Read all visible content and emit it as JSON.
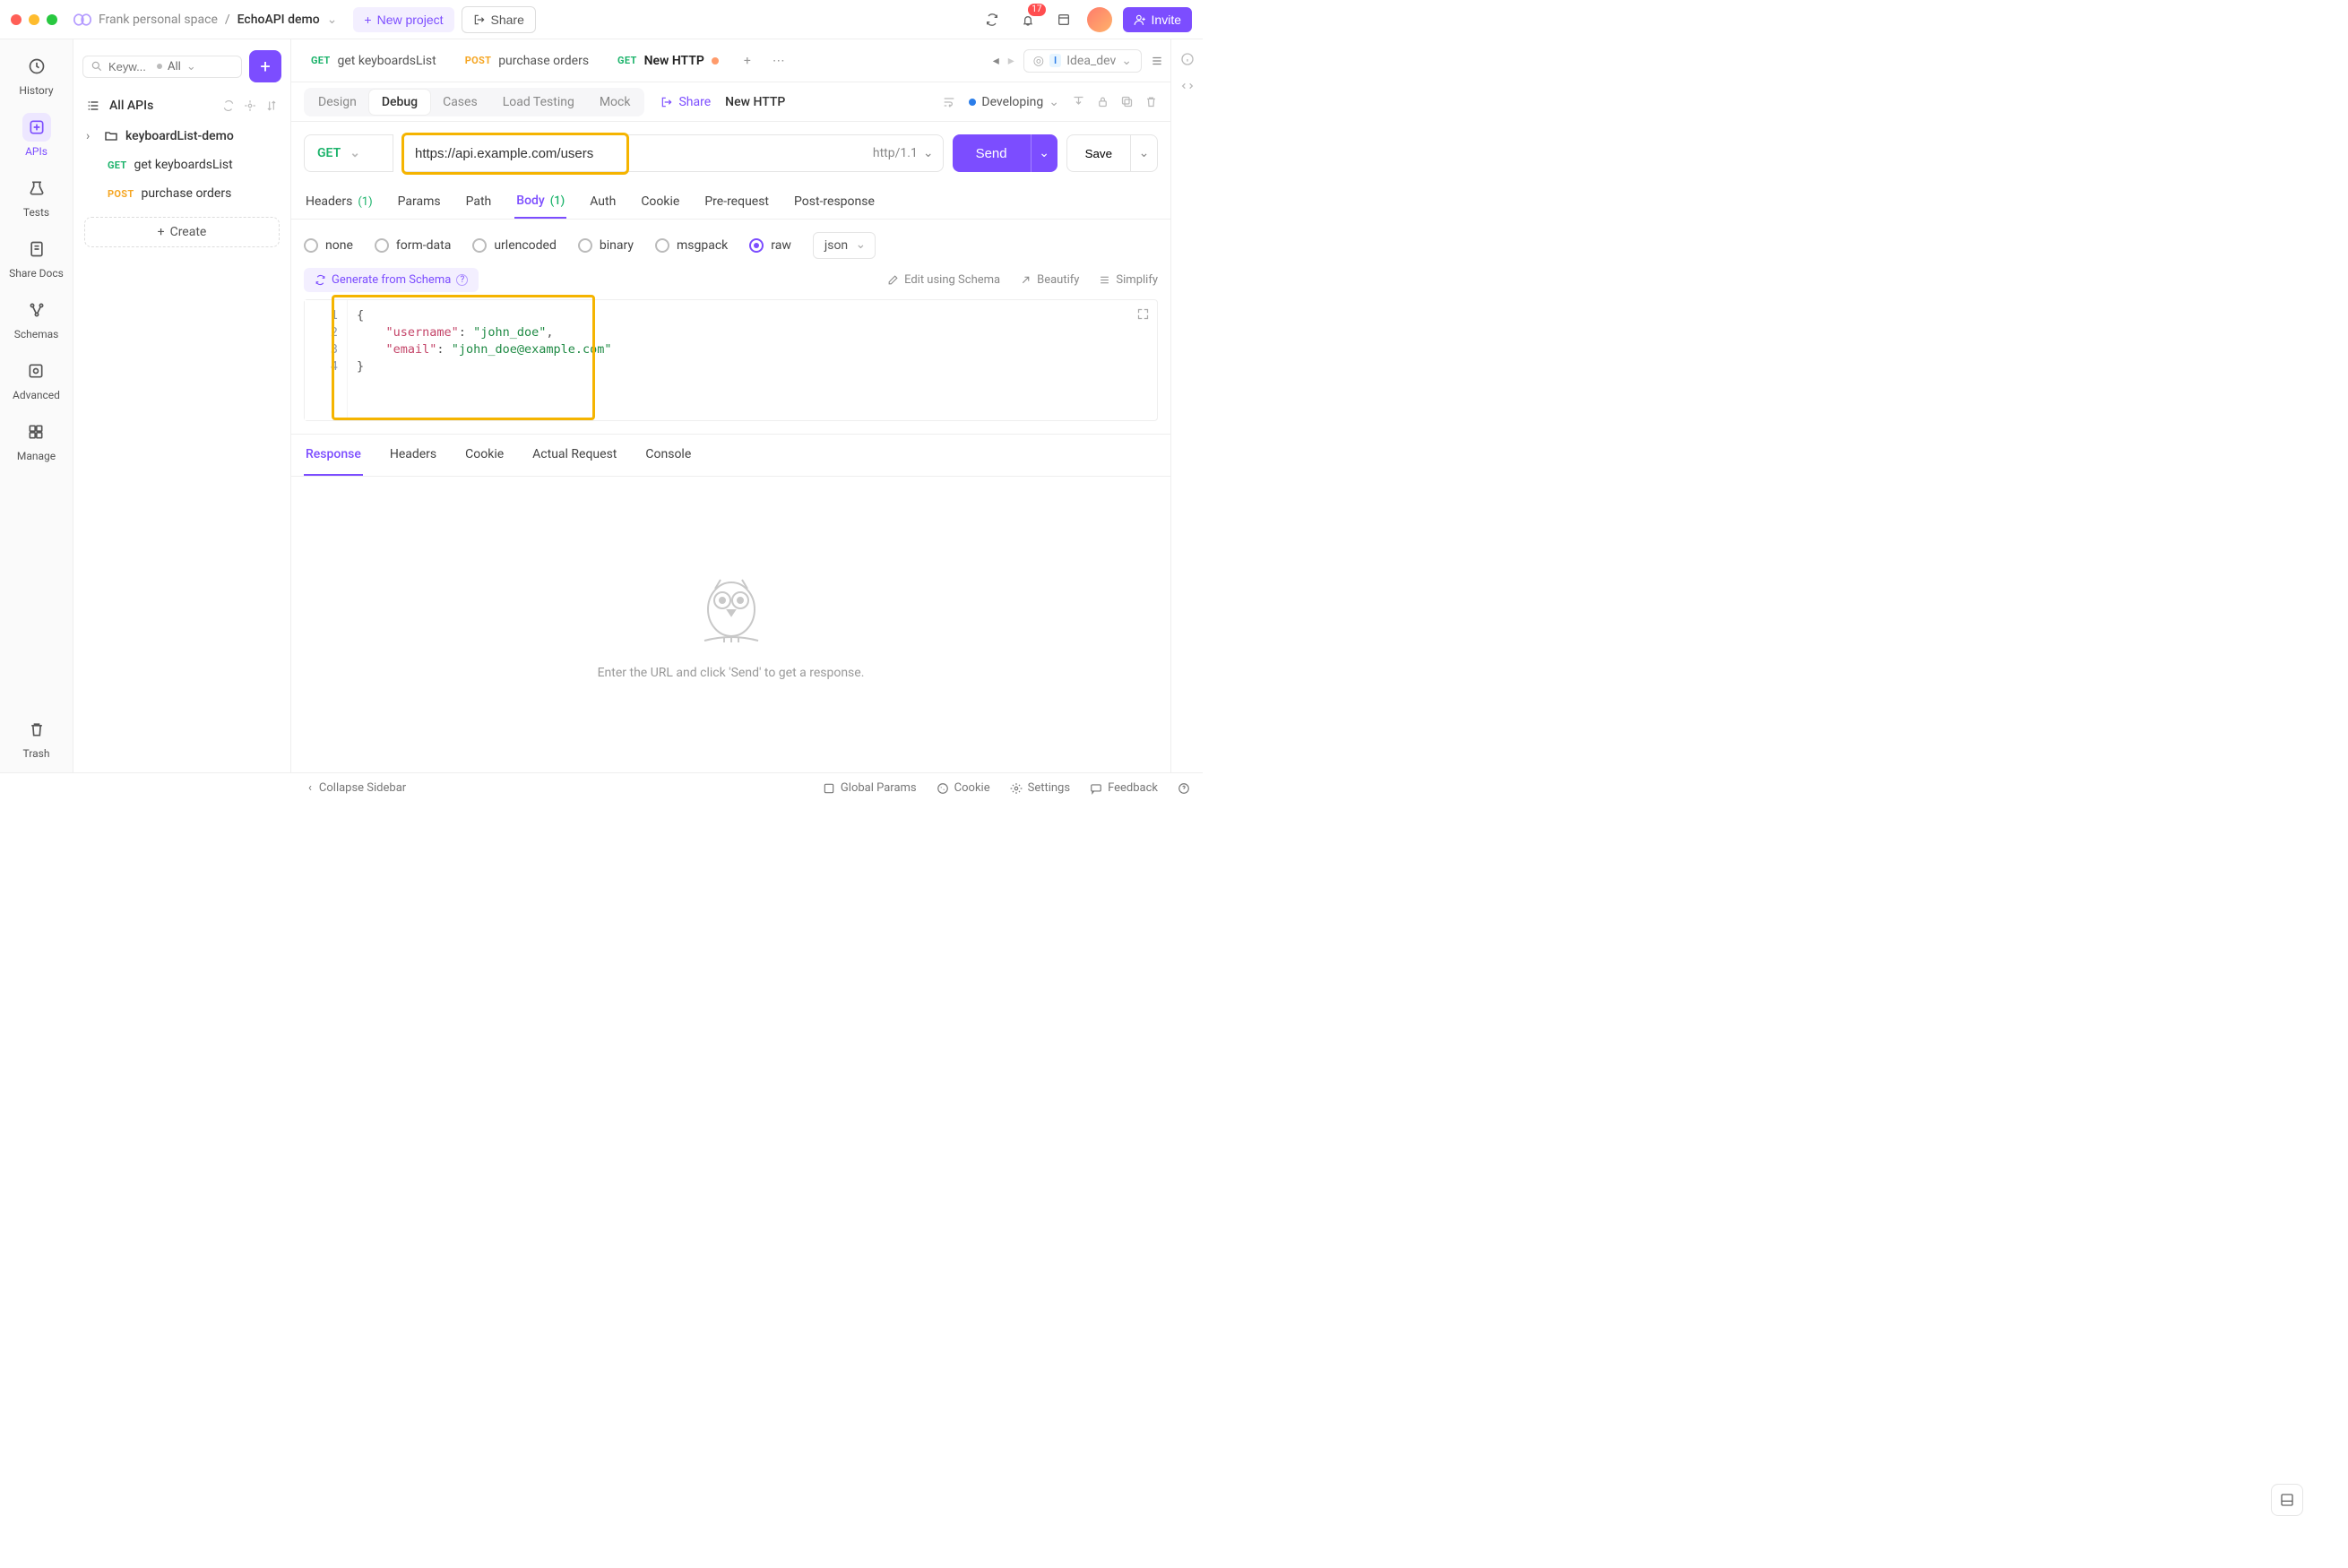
{
  "titlebar": {
    "workspace": "Frank personal space",
    "project": "EchoAPI demo",
    "new_project": "New project",
    "share": "Share",
    "notif_count": "17",
    "invite": "Invite"
  },
  "nav": {
    "history": "History",
    "apis": "APIs",
    "tests": "Tests",
    "share_docs": "Share Docs",
    "schemas": "Schemas",
    "advanced": "Advanced",
    "manage": "Manage",
    "trash": "Trash"
  },
  "sidebar": {
    "search_placeholder": "Keyw...",
    "filter_label": "All",
    "all_apis": "All APIs",
    "folder": "keyboardList-demo",
    "items": [
      {
        "method": "GET",
        "name": "get keyboardsList"
      },
      {
        "method": "POST",
        "name": "purchase orders"
      }
    ],
    "create": "Create"
  },
  "tabs": {
    "items": [
      {
        "method": "GET",
        "method_class": "m-get",
        "label": "get keyboardsList"
      },
      {
        "method": "POST",
        "method_class": "m-post",
        "label": "purchase orders"
      },
      {
        "method": "GET",
        "method_class": "m-get",
        "label": "New HTTP",
        "unsaved": true
      }
    ],
    "env": "Idea_dev"
  },
  "subtabs": {
    "design": "Design",
    "debug": "Debug",
    "cases": "Cases",
    "load_testing": "Load Testing",
    "mock": "Mock",
    "share": "Share",
    "api_name": "New HTTP",
    "status": "Developing"
  },
  "request": {
    "method": "GET",
    "url": "https://api.example.com/users",
    "protocol": "http/1.1",
    "send": "Send",
    "save": "Save"
  },
  "reqtabs": {
    "headers": "Headers",
    "headers_count": "(1)",
    "params": "Params",
    "path": "Path",
    "body": "Body",
    "body_count": "(1)",
    "auth": "Auth",
    "cookie": "Cookie",
    "pre_request": "Pre-request",
    "post_response": "Post-response"
  },
  "body_types": {
    "none": "none",
    "form": "form-data",
    "url": "urlencoded",
    "binary": "binary",
    "msgpack": "msgpack",
    "raw": "raw",
    "format": "json"
  },
  "editor_toolbar": {
    "generate": "Generate from Schema",
    "edit_schema": "Edit using Schema",
    "beautify": "Beautify",
    "simplify": "Simplify"
  },
  "code": {
    "line_nums": [
      "1",
      "2",
      "3",
      "4"
    ],
    "raw_display_only": "placeholder"
  },
  "response": {
    "tabs": {
      "response": "Response",
      "headers": "Headers",
      "cookie": "Cookie",
      "actual": "Actual Request",
      "console": "Console"
    },
    "empty_msg": "Enter the URL and click 'Send' to get a response."
  },
  "statusbar": {
    "collapse": "Collapse Sidebar",
    "global_params": "Global Params",
    "cookie": "Cookie",
    "settings": "Settings",
    "feedback": "Feedback"
  }
}
